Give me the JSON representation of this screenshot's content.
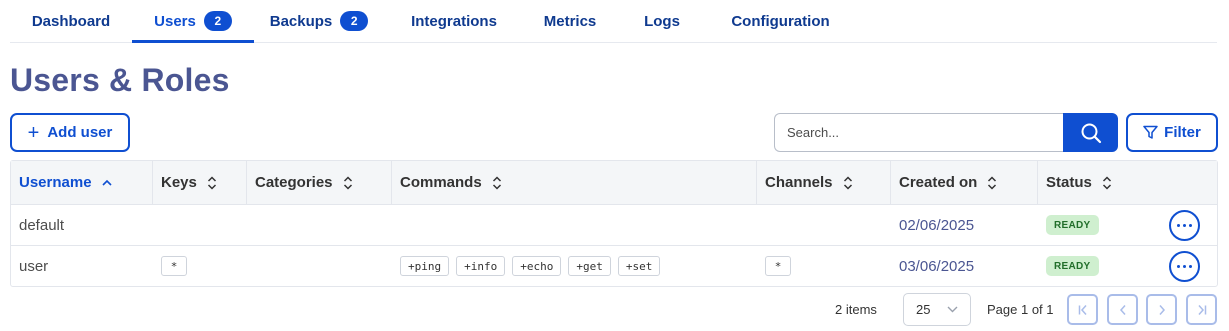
{
  "tabs": [
    {
      "label": "Dashboard",
      "badge": null
    },
    {
      "label": "Users",
      "badge": "2"
    },
    {
      "label": "Backups",
      "badge": "2"
    },
    {
      "label": "Integrations",
      "badge": null
    },
    {
      "label": "Metrics",
      "badge": null
    },
    {
      "label": "Logs",
      "badge": null
    },
    {
      "label": "Configuration",
      "badge": null
    }
  ],
  "active_tab": "Users",
  "page_title": "Users & Roles",
  "add_user_label": "Add user",
  "search": {
    "placeholder": "Search...",
    "value": ""
  },
  "filter_label": "Filter",
  "table": {
    "columns": [
      "Username",
      "Keys",
      "Categories",
      "Commands",
      "Channels",
      "Created on",
      "Status"
    ],
    "sorted_column": "Username",
    "rows": [
      {
        "username": "default",
        "keys": [],
        "categories": [],
        "commands": [],
        "channels": [],
        "created_on": "02/06/2025",
        "status": "READY"
      },
      {
        "username": "user",
        "keys": [
          "*"
        ],
        "categories": [],
        "commands": [
          "+ping",
          "+info",
          "+echo",
          "+get",
          "+set"
        ],
        "channels": [
          "*"
        ],
        "created_on": "03/06/2025",
        "status": "READY"
      }
    ]
  },
  "pagination": {
    "items_label": "2 items",
    "page_size": "25",
    "page_label": "Page 1 of 1"
  },
  "colors": {
    "accent": "#0f4fd1",
    "title": "#4b5692",
    "status_ready_bg": "#cfefcf",
    "status_ready_text": "#216e2a"
  }
}
